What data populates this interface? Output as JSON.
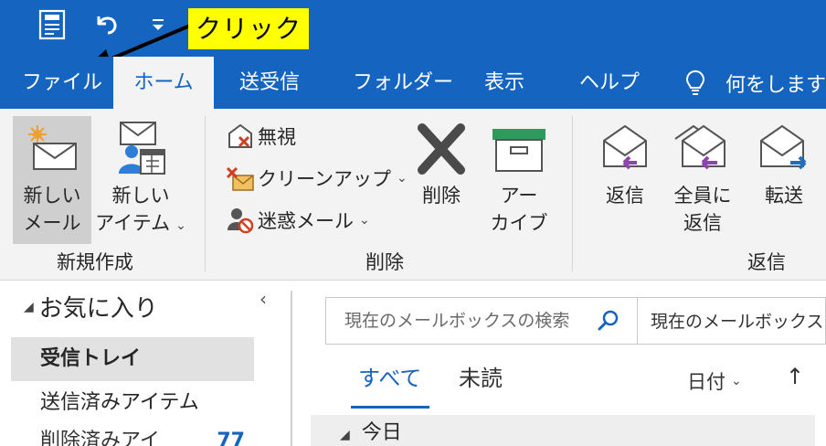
{
  "callout": {
    "text": "クリック"
  },
  "tabs": [
    {
      "label": "ファイル"
    },
    {
      "label": "ホーム"
    },
    {
      "label": "送受信"
    },
    {
      "label": "フォルダー"
    },
    {
      "label": "表示"
    },
    {
      "label": "ヘルプ"
    }
  ],
  "tellme": {
    "text": "何をしますか"
  },
  "ribbon": {
    "new_mail": {
      "line1": "新しい",
      "line2": "メール"
    },
    "new_item": {
      "line1": "新しい",
      "line2": "アイテム"
    },
    "ignore": "無視",
    "cleanup": "クリーンアップ",
    "junk": "迷惑メール",
    "delete": "削除",
    "archive": {
      "line1": "アー",
      "line2": "カイブ"
    },
    "reply": "返信",
    "reply_all": {
      "line1": "全員に",
      "line2": "返信"
    },
    "forward": "転送",
    "groups": {
      "new": "新規作成",
      "delete": "削除",
      "respond": "返信"
    },
    "dropdown_glyph": "⌄"
  },
  "nav": {
    "favorites": "お気に入り",
    "collapse": "‹",
    "items": [
      {
        "label": "受信トレイ"
      },
      {
        "label": "送信済みアイテム"
      },
      {
        "label": "削除済みアイ",
        "count": "77"
      }
    ]
  },
  "search": {
    "placeholder": "現在のメールボックスの検索",
    "scope": "現在のメールボックス"
  },
  "filters": {
    "all": "すべて",
    "unread": "未読",
    "sort": "日付",
    "sort_caret": "⌄",
    "sort_dir": "↑"
  },
  "list": {
    "group_today": "今日"
  },
  "colors": {
    "accent": "#1565c0",
    "callout_bg": "#ffff00",
    "ribbon_bg": "#f3f3f3",
    "purple_arrow": "#8e44ad",
    "blue_arrow": "#1f6fbf"
  },
  "icons": {
    "save": "save-icon",
    "undo": "undo-icon",
    "customize": "customize-icon",
    "tellme": "lightbulb-icon",
    "search": "search-icon"
  }
}
